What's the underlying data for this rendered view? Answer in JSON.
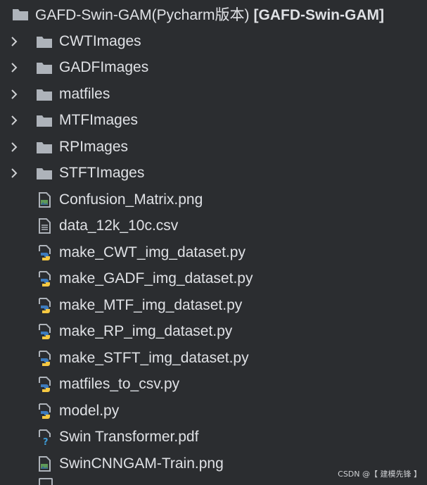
{
  "root": {
    "name": "GAFD-Swin-GAM(Pycharm版本)",
    "module": "[GAFD-Swin-GAM]",
    "icon": "folder-icon"
  },
  "folders": [
    {
      "label": "CWTImages",
      "icon": "folder-icon"
    },
    {
      "label": "GADFImages",
      "icon": "folder-icon"
    },
    {
      "label": "matfiles",
      "icon": "folder-icon"
    },
    {
      "label": "MTFImages",
      "icon": "folder-icon"
    },
    {
      "label": "RPImages",
      "icon": "folder-icon"
    },
    {
      "label": "STFTImages",
      "icon": "folder-icon"
    }
  ],
  "files": [
    {
      "label": "Confusion_Matrix.png",
      "icon": "image-file-icon"
    },
    {
      "label": "data_12k_10c.csv",
      "icon": "text-file-icon"
    },
    {
      "label": "make_CWT_img_dataset.py",
      "icon": "python-file-icon"
    },
    {
      "label": "make_GADF_img_dataset.py",
      "icon": "python-file-icon"
    },
    {
      "label": "make_MTF_img_dataset.py",
      "icon": "python-file-icon"
    },
    {
      "label": "make_RP_img_dataset.py",
      "icon": "python-file-icon"
    },
    {
      "label": "make_STFT_img_dataset.py",
      "icon": "python-file-icon"
    },
    {
      "label": "matfiles_to_csv.py",
      "icon": "python-file-icon"
    },
    {
      "label": "model.py",
      "icon": "python-file-icon"
    },
    {
      "label": "Swin Transformer.pdf",
      "icon": "unknown-file-icon"
    },
    {
      "label": "SwinCNNGAM-Train.png",
      "icon": "image-file-icon"
    }
  ],
  "watermark": "CSDN @【 建模先锋 】",
  "colors": {
    "background": "#2b2d30",
    "text": "#dfe1e5",
    "folder": "#aeb3ba",
    "python_blue": "#3d7bbd",
    "python_yellow": "#f5c842",
    "image_green": "#5f9a57"
  }
}
